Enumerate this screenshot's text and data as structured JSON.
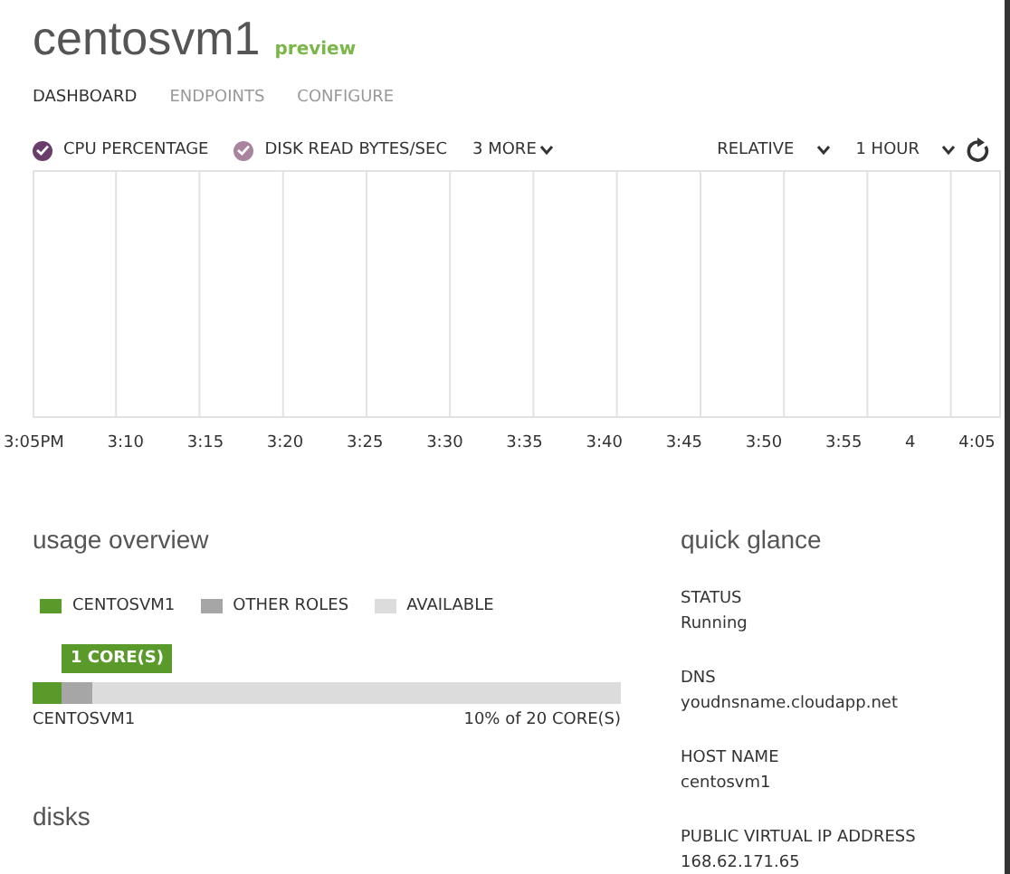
{
  "title": "centosvm1",
  "badge": "preview",
  "tabs": [
    {
      "label": "DASHBOARD",
      "selected": true
    },
    {
      "label": "ENDPOINTS",
      "selected": false
    },
    {
      "label": "CONFIGURE",
      "selected": false
    }
  ],
  "metrics": [
    {
      "label": "CPU PERCENTAGE",
      "checked": true,
      "color": "#6a3d6a"
    },
    {
      "label": "DISK READ BYTES/SEC",
      "checked": true,
      "color": "#a8849f"
    }
  ],
  "more": "3 MORE",
  "range": [
    {
      "label": "RELATIVE"
    },
    {
      "label": "1 HOUR"
    }
  ],
  "chart": {
    "x_labels": [
      "3:05PM",
      "3:10",
      "3:15",
      "3:20",
      "3:25",
      "3:30",
      "3:35",
      "3:40",
      "3:45",
      "3:50",
      "3:55",
      "4",
      "4:05"
    ]
  },
  "usage": {
    "heading": "usage overview",
    "legend": [
      {
        "label": "CENTOSVM1",
        "color": "#5a9a2a"
      },
      {
        "label": "OTHER ROLES",
        "color": "#a6a6a6"
      },
      {
        "label": "AVAILABLE",
        "color": "#dcdcdc"
      }
    ],
    "callout": "1 CORE(S)",
    "segments": [
      {
        "level": 0.05,
        "color": "#5a9a2a"
      },
      {
        "level": 0.05,
        "color": "#a6a6a6"
      }
    ],
    "bar_label": "CENTOSVM1",
    "bar_total": "10% of 20 CORE(S)"
  },
  "disks": {
    "heading": "disks"
  },
  "glance": {
    "heading": "quick glance",
    "items": [
      {
        "label": "STATUS",
        "value": "Running"
      },
      {
        "label": "DNS",
        "value": "youdnsname.cloudapp.net"
      },
      {
        "label": "HOST NAME",
        "value": "centosvm1"
      },
      {
        "label": "PUBLIC VIRTUAL IP ADDRESS",
        "value": "168.62.171.65"
      }
    ]
  }
}
